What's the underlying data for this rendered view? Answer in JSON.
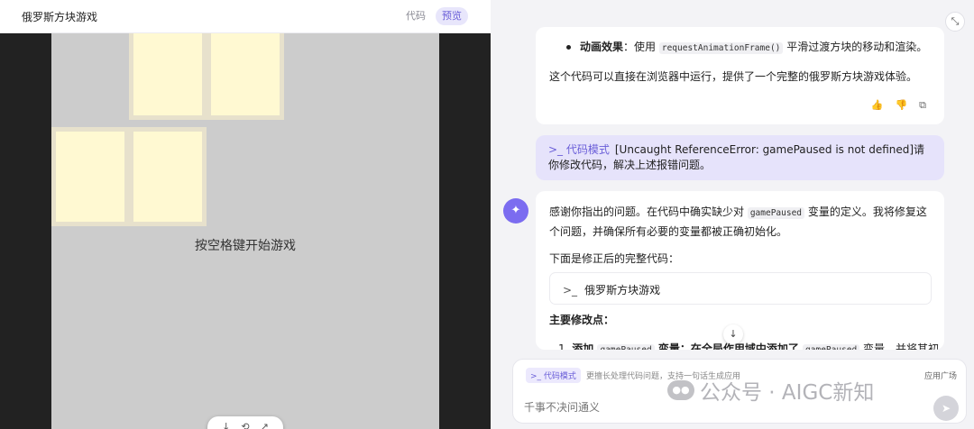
{
  "left": {
    "title": "俄罗斯方块游戏",
    "tabs": [
      "代码",
      "预览"
    ],
    "active_tab": "预览",
    "game_message": "按空格键开始游戏",
    "toolbar_icons": [
      "↓",
      "⟲",
      "↗"
    ],
    "colors": {
      "board": "#cccccc",
      "stage": "#222222",
      "block_fill": "#fff9d2",
      "block_border": "#e7e1cc"
    }
  },
  "right": {
    "collapse_icon": "⤡",
    "previous_answer": {
      "bullet_label": "动画效果",
      "bullet_pre": "：使用 ",
      "bullet_code": "requestAnimationFrame()",
      "bullet_post": " 平滑过渡方块的移动和渲染。",
      "summary": "这个代码可以直接在浏览器中运行，提供了一个完整的俄罗斯方块游戏体验。",
      "actions": [
        "👍",
        "👎",
        "⧉"
      ]
    },
    "user_message": {
      "mode": ">_ 代码模式",
      "text": "[Uncaught ReferenceError: gamePaused is not defined]请你修改代码，解决上述报错问题。"
    },
    "assistant": {
      "p1_pre": "感谢你指出的问题。在代码中确实缺少对 ",
      "p1_code": "gamePaused",
      "p1_post": " 变量的定义。我将修复这个问题，并确保所有必要的变量都被正确初始化。",
      "p2": "下面是修正后的完整代码：",
      "code_card": "俄罗斯方块游戏",
      "code_prompt": ">_",
      "p3": "主要修改点：",
      "li1_num": "1.",
      "li1_bold": "添加 ",
      "li1_code": "gamePaused",
      "li1_text": " 变量：在全局作用域中添加了 ",
      "li1_code2": "gamePaused",
      "li1_tail": " 变量，并将其初"
    },
    "input": {
      "mode": ">_ 代码模式",
      "hint": "更擅长处理代码问题，支持一句话生成应用",
      "market": "应用广场",
      "placeholder": "千事不决问通义",
      "send_icon": "➤"
    },
    "watermark": "公众号 · AIGC新知"
  }
}
